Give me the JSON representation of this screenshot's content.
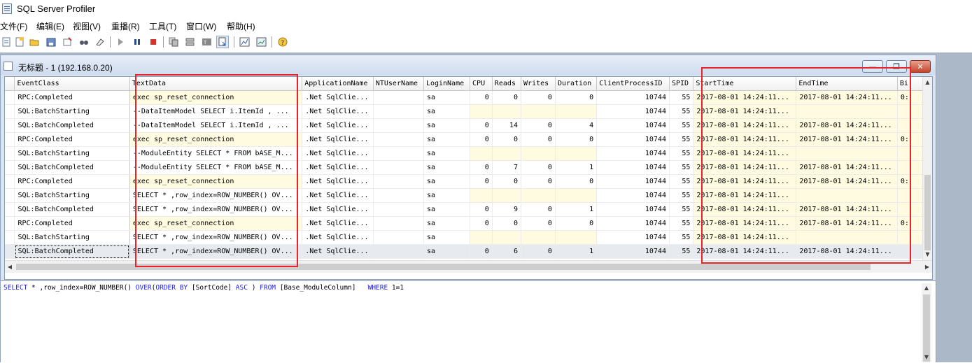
{
  "app": {
    "title": "SQL Server Profiler"
  },
  "menu": [
    "文件(F)",
    "编辑(E)",
    "视图(V)",
    "重播(R)",
    "工具(T)",
    "窗口(W)",
    "帮助(H)"
  ],
  "toolbar": {
    "icons": [
      "new-trace-icon",
      "open-icon",
      "save-icon",
      "properties-icon",
      "find-icon",
      "clear-icon",
      "run-icon",
      "pause-icon",
      "stop-icon",
      "copy-icon",
      "cut-icon",
      "template-icon",
      "paste-icon",
      "chart-icon",
      "graph-icon",
      "help-icon"
    ]
  },
  "child_window": {
    "title": "无标题 - 1 (192.168.0.20)"
  },
  "grid": {
    "columns": [
      "EventClass",
      "TextData",
      "ApplicationName",
      "NTUserName",
      "LoginName",
      "CPU",
      "Reads",
      "Writes",
      "Duration",
      "ClientProcessID",
      "SPID",
      "StartTime",
      "EndTime",
      "Bi"
    ],
    "rows": [
      [
        "RPC:Completed",
        "exec sp_reset_connection",
        ".Net SqlClie...",
        "",
        "sa",
        "0",
        "0",
        "0",
        "0",
        "10744",
        "55",
        "2017-08-01 14:24:11...",
        "2017-08-01 14:24:11...",
        "0:"
      ],
      [
        "SQL:BatchStarting",
        "--DataItemModel SELECT  i.ItemId ,  ...",
        ".Net SqlClie...",
        "",
        "sa",
        "",
        "",
        "",
        "",
        "10744",
        "55",
        "2017-08-01 14:24:11...",
        "",
        ""
      ],
      [
        "SQL:BatchCompleted",
        "--DataItemModel SELECT  i.ItemId ,  ...",
        ".Net SqlClie...",
        "",
        "sa",
        "0",
        "14",
        "0",
        "4",
        "10744",
        "55",
        "2017-08-01 14:24:11...",
        "2017-08-01 14:24:11...",
        ""
      ],
      [
        "RPC:Completed",
        "exec sp_reset_connection",
        ".Net SqlClie...",
        "",
        "sa",
        "0",
        "0",
        "0",
        "0",
        "10744",
        "55",
        "2017-08-01 14:24:11...",
        "2017-08-01 14:24:11...",
        "0:"
      ],
      [
        "SQL:BatchStarting",
        "--ModuleEntity SELECT * FROM bASE_M...",
        ".Net SqlClie...",
        "",
        "sa",
        "",
        "",
        "",
        "",
        "10744",
        "55",
        "2017-08-01 14:24:11...",
        "",
        ""
      ],
      [
        "SQL:BatchCompleted",
        "--ModuleEntity SELECT * FROM bASE_M...",
        ".Net SqlClie...",
        "",
        "sa",
        "0",
        "7",
        "0",
        "1",
        "10744",
        "55",
        "2017-08-01 14:24:11...",
        "2017-08-01 14:24:11...",
        ""
      ],
      [
        "RPC:Completed",
        "exec sp_reset_connection",
        ".Net SqlClie...",
        "",
        "sa",
        "0",
        "0",
        "0",
        "0",
        "10744",
        "55",
        "2017-08-01 14:24:11...",
        "2017-08-01 14:24:11...",
        "0:"
      ],
      [
        "SQL:BatchStarting",
        "SELECT * ,row_index=ROW_NUMBER() OV...",
        ".Net SqlClie...",
        "",
        "sa",
        "",
        "",
        "",
        "",
        "10744",
        "55",
        "2017-08-01 14:24:11...",
        "",
        ""
      ],
      [
        "SQL:BatchCompleted",
        "SELECT * ,row_index=ROW_NUMBER() OV...",
        ".Net SqlClie...",
        "",
        "sa",
        "0",
        "9",
        "0",
        "1",
        "10744",
        "55",
        "2017-08-01 14:24:11...",
        "2017-08-01 14:24:11...",
        ""
      ],
      [
        "RPC:Completed",
        "exec sp_reset_connection",
        ".Net SqlClie...",
        "",
        "sa",
        "0",
        "0",
        "0",
        "0",
        "10744",
        "55",
        "2017-08-01 14:24:11...",
        "2017-08-01 14:24:11...",
        "0:"
      ],
      [
        "SQL:BatchStarting",
        "SELECT * ,row_index=ROW_NUMBER() OV...",
        ".Net SqlClie...",
        "",
        "sa",
        "",
        "",
        "",
        "",
        "10744",
        "55",
        "2017-08-01 14:24:11...",
        "",
        ""
      ],
      [
        "SQL:BatchCompleted",
        "SELECT * ,row_index=ROW_NUMBER() OV...",
        ".Net SqlClie...",
        "",
        "sa",
        "0",
        "6",
        "0",
        "1",
        "10744",
        "55",
        "2017-08-01 14:24:11...",
        "2017-08-01 14:24:11...",
        ""
      ]
    ],
    "selected_row": 11
  },
  "detail": {
    "sql_parts": [
      {
        "t": "SELECT",
        "kw": true
      },
      {
        "t": " * ,row_index=ROW_NUMBER() ",
        "kw": false
      },
      {
        "t": "OVER",
        "kw": true
      },
      {
        "t": "(",
        "kw": false
      },
      {
        "t": "ORDER BY",
        "kw": true
      },
      {
        "t": " [SortCode] ",
        "kw": false
      },
      {
        "t": "ASC",
        "kw": true
      },
      {
        "t": " ) ",
        "kw": false
      },
      {
        "t": "FROM",
        "kw": true
      },
      {
        "t": " [Base_ModuleColumn]   ",
        "kw": false
      },
      {
        "t": "WHERE",
        "kw": true
      },
      {
        "t": " 1=1",
        "kw": false
      }
    ]
  },
  "colors": {
    "highlight_box": "#e8232a",
    "keyword": "#1a1aff",
    "cell_highlight": "#fffbe0"
  }
}
